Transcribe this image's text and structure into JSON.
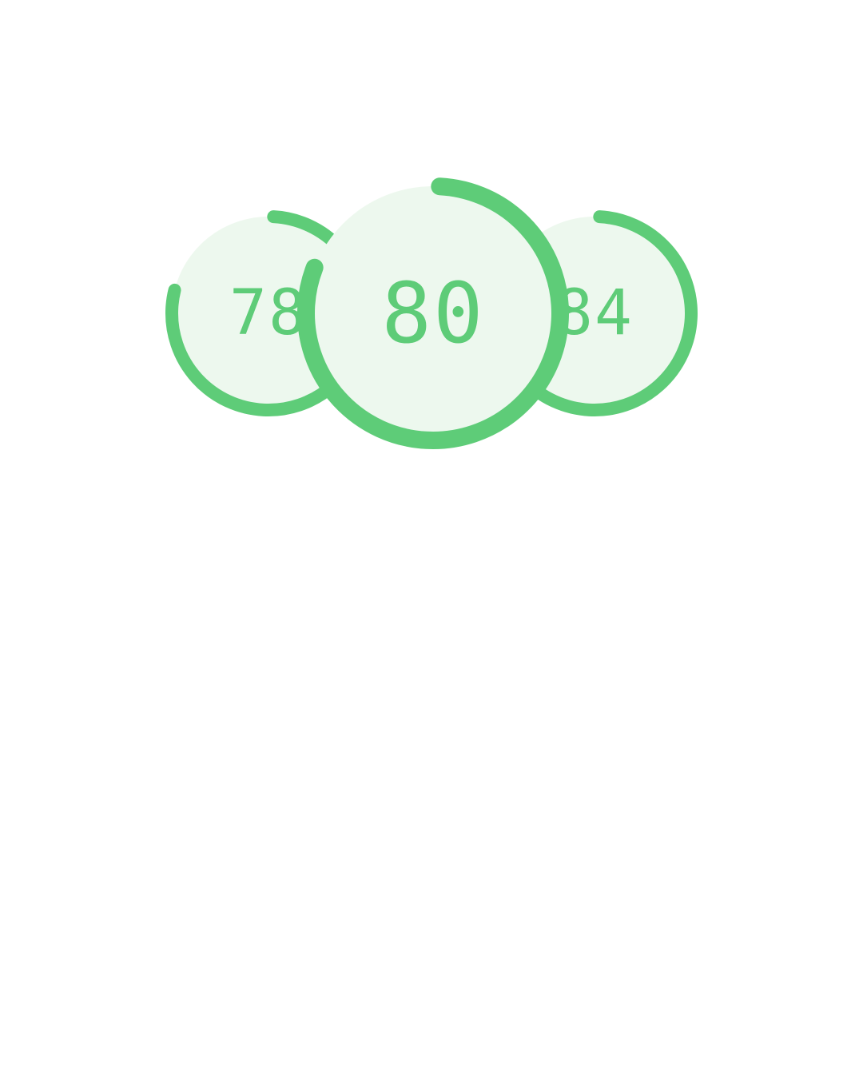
{
  "colors": {
    "accent": "#5ecc78",
    "track_fill": "#edf8ee",
    "background": "#ffffff"
  },
  "gauges": [
    {
      "id": "left",
      "value": "78",
      "progress": 0.78
    },
    {
      "id": "center",
      "value": "80",
      "progress": 0.8
    },
    {
      "id": "right",
      "value": "84",
      "progress": 0.84
    }
  ]
}
